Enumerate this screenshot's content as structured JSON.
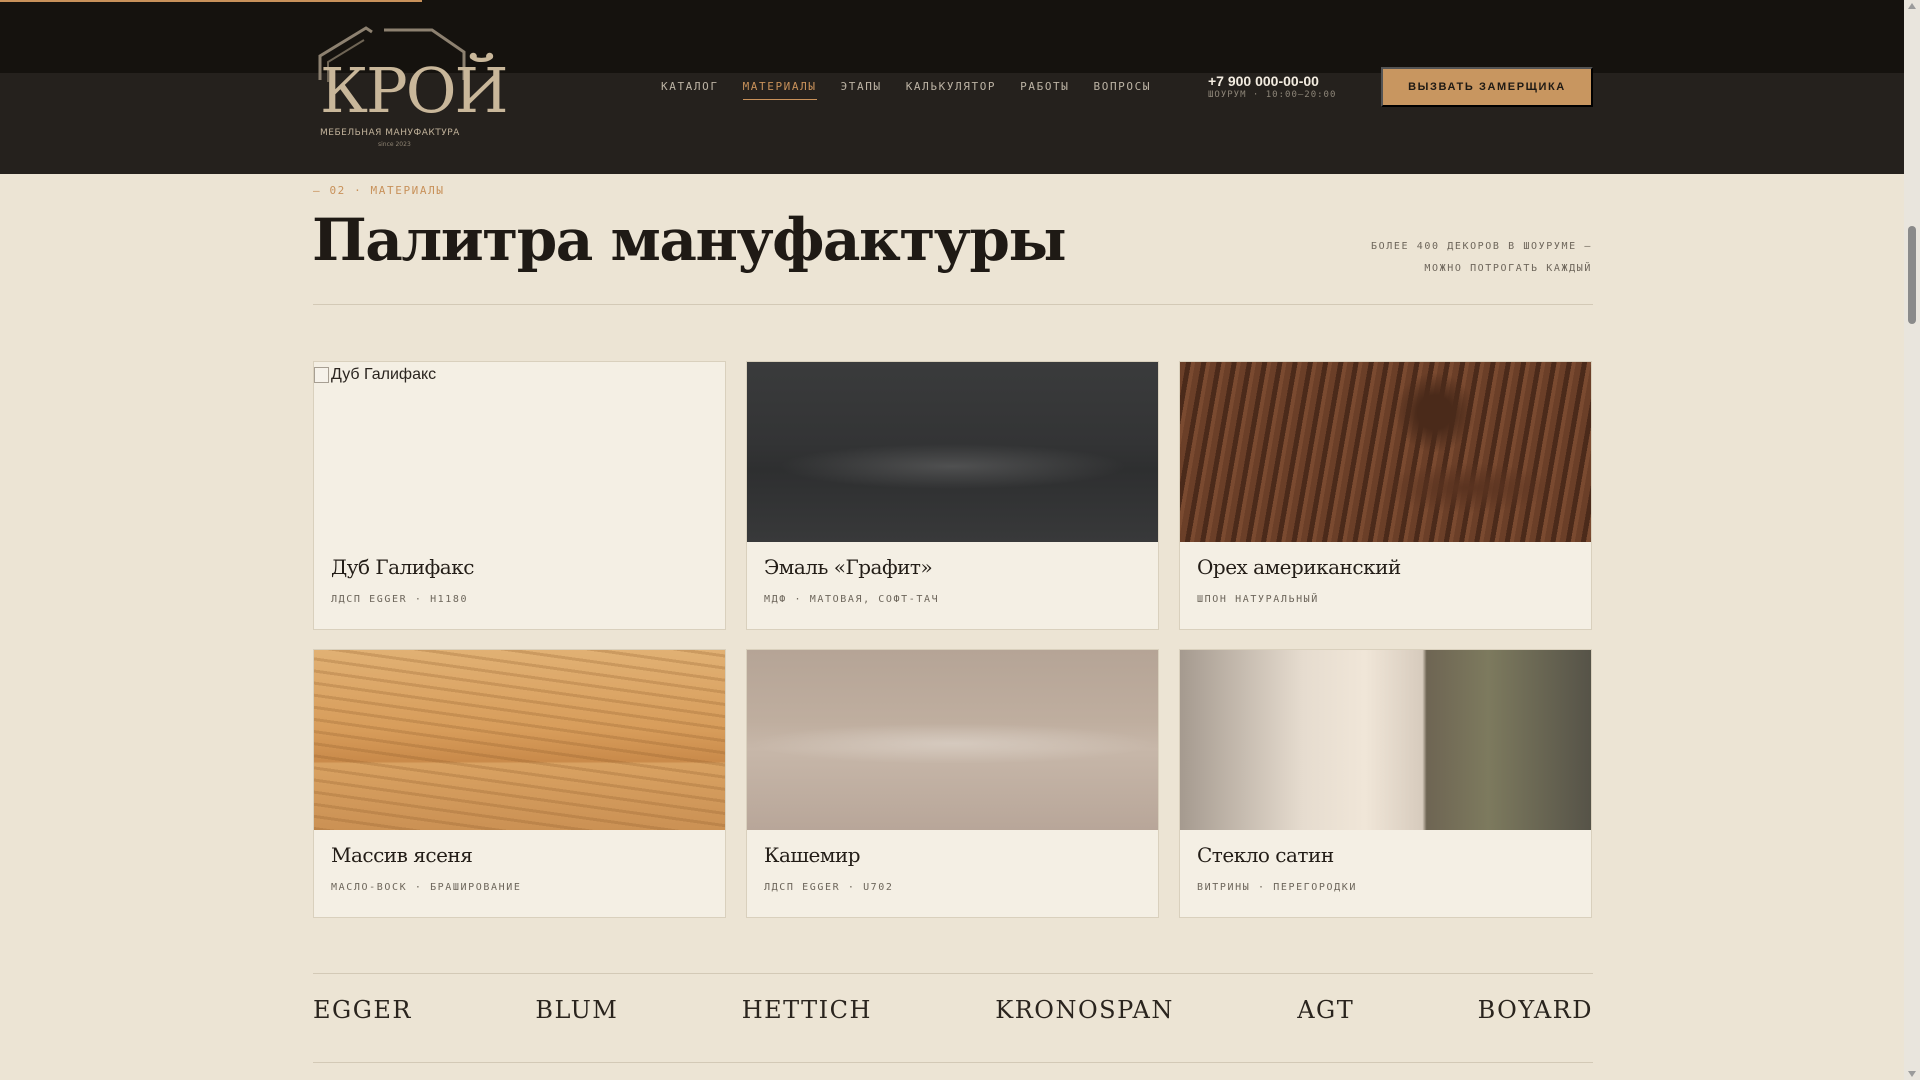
{
  "header": {
    "logo": {
      "word": "КРОЙ",
      "subtitle": "МЕБЕЛЬНАЯ МАНУФАКТУРА",
      "since": "since 2023"
    },
    "nav": [
      {
        "label": "КАТАЛОГ",
        "active": false
      },
      {
        "label": "МАТЕРИАЛЫ",
        "active": true
      },
      {
        "label": "ЭТАПЫ",
        "active": false
      },
      {
        "label": "КАЛЬКУЛЯТОР",
        "active": false
      },
      {
        "label": "РАБОТЫ",
        "active": false
      },
      {
        "label": "ВОПРОСЫ",
        "active": false
      }
    ],
    "phone": "+7 900 000-00-00",
    "hours": "ШОУРУМ · 10:00–20:00",
    "cta_label": "ВЫЗВАТЬ ЗАМЕРЩИКА"
  },
  "section": {
    "eyebrow": "— 02 · МАТЕРИАЛЫ",
    "title": "Палитра мануфактуры",
    "aside_line1": "БОЛЕЕ 400 ДЕКОРОВ В ШОУРУМЕ —",
    "aside_line2": "МОЖНО ПОТРОГАТЬ КАЖДЫЙ"
  },
  "materials": [
    {
      "name": "Дуб Галифакс",
      "spec": "ЛДСП EGGER · H1180",
      "image_alt": "Дуб Галифакс",
      "image_broken": true
    },
    {
      "name": "Эмаль «Графит»",
      "spec": "МДФ · МАТОВАЯ, СОФТ-ТАЧ"
    },
    {
      "name": "Орех американский",
      "spec": "ШПОН НАТУРАЛЬНЫЙ"
    },
    {
      "name": "Массив ясеня",
      "spec": "МАСЛО-ВОСК · БРАШИРОВАНИЕ"
    },
    {
      "name": "Кашемир",
      "spec": "ЛДСП EGGER · U702"
    },
    {
      "name": "Стекло сатин",
      "spec": "ВИТРИНЫ · ПЕРЕГОРОДКИ"
    }
  ],
  "brands": [
    "EGGER",
    "BLUM",
    "HETTICH",
    "KRONOSPAN",
    "AGT",
    "BOYARD"
  ],
  "colors": {
    "accent": "#c8915a",
    "header_bg": "#25211d",
    "page_bg": "#ece4d4",
    "text_dark": "#1f1a15"
  }
}
